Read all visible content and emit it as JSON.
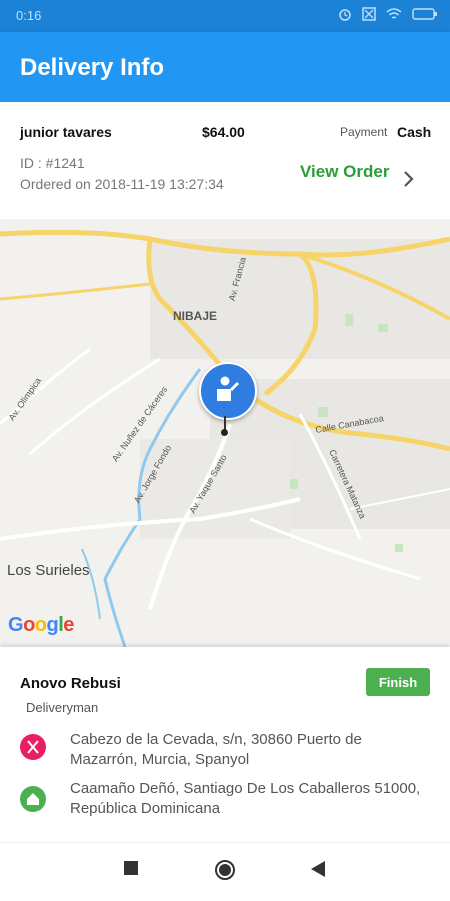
{
  "status_bar": {
    "time": "0:16",
    "icons": [
      "alarm-icon",
      "mute-icon",
      "wifi-icon",
      "battery-icon"
    ]
  },
  "app_bar": {
    "title": "Delivery Info",
    "color": "#2196f3"
  },
  "order": {
    "customer_name": "junior tavares",
    "amount": "$64.00",
    "payment_label": "Payment",
    "payment_method": "Cash",
    "order_id": "ID : #1241",
    "ordered_on": "Ordered on 2018-11-19 13:27:34",
    "view_order_label": "View Order",
    "view_order_color": "#2a9d3a"
  },
  "map": {
    "labels": [
      "NIBAJE",
      "Los Surieles",
      "Av. Olimpica",
      "Av. Nuñez de Cáceres",
      "Av. Jorge Fondo",
      "Av. Yaque Santo",
      "Calle Canabacoa",
      "Carretera Matanza",
      "Av. Francia"
    ],
    "attribution": "Google"
  },
  "delivery": {
    "deliveryman_name": "Anovo Rebusi",
    "role": "Deliveryman",
    "finish_label": "Finish",
    "finish_color": "#4caf50",
    "pickup_address": "Cabezo de la Cevada, s/n, 30860 Puerto de Mazarrón, Murcia, Spanyol",
    "dropoff_address": "Caamaño Deñó, Santiago De Los Caballeros 51000, República Dominicana"
  },
  "nav_bar": {
    "buttons": [
      "recents-button",
      "home-button",
      "back-button"
    ]
  }
}
